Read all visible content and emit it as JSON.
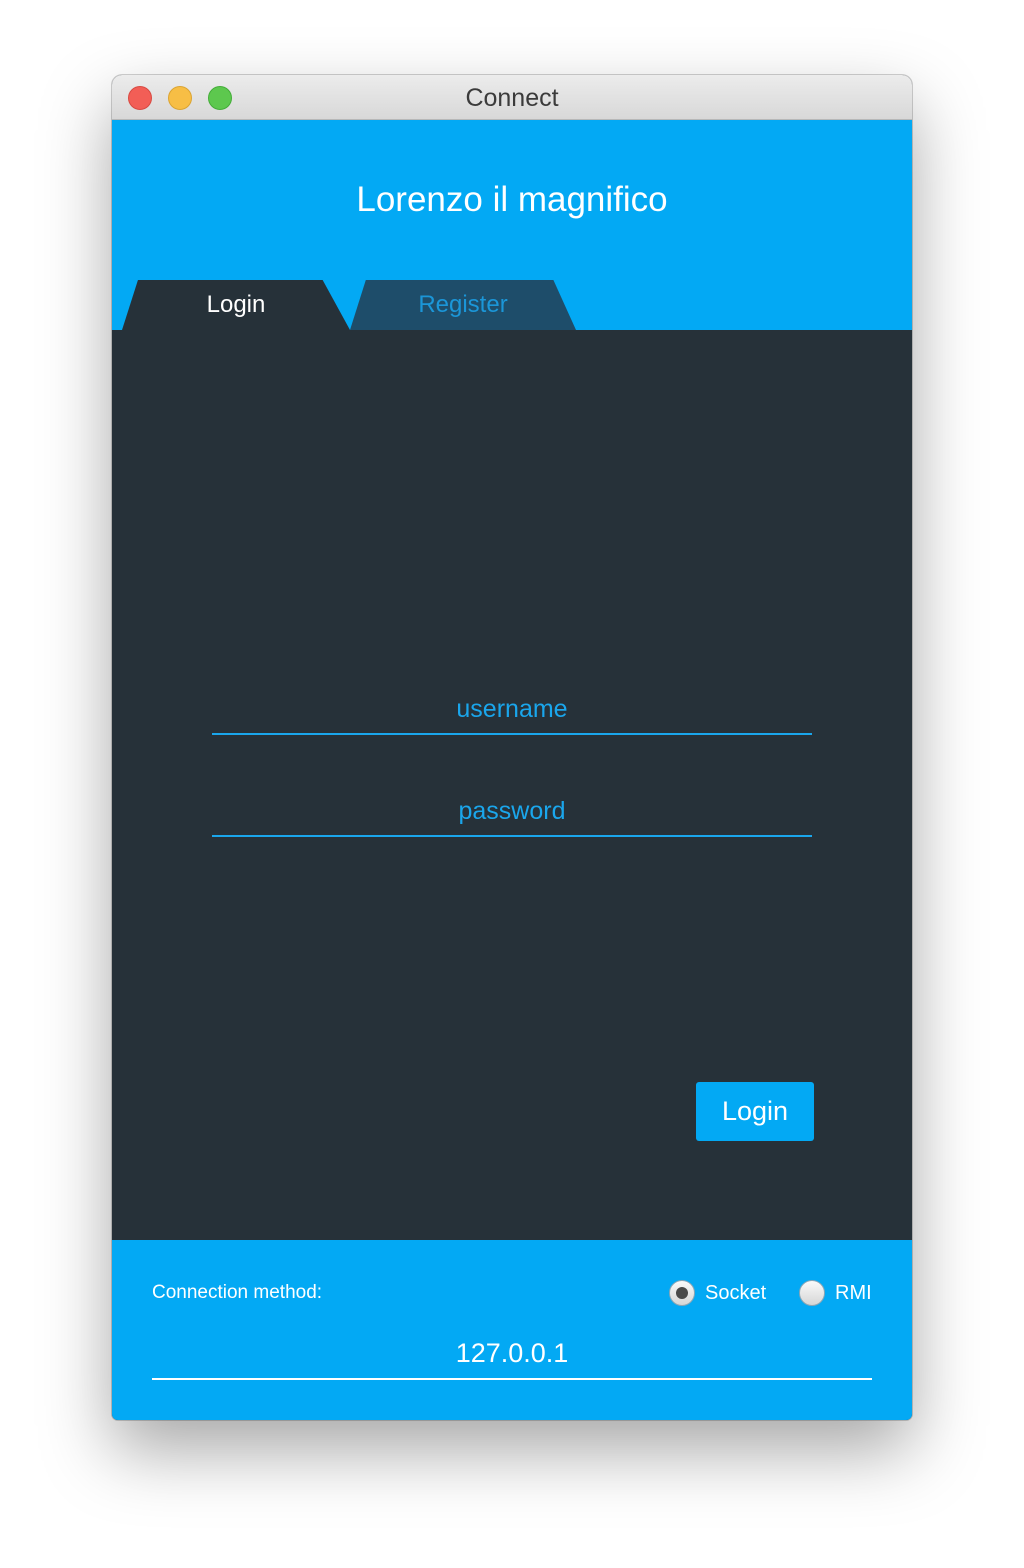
{
  "window": {
    "title": "Connect"
  },
  "header": {
    "app_title": "Lorenzo il magnifico",
    "tabs": [
      {
        "label": "Login",
        "selected": true
      },
      {
        "label": "Register",
        "selected": false
      }
    ]
  },
  "login_form": {
    "username_placeholder": "username",
    "password_placeholder": "password",
    "submit_label": "Login"
  },
  "footer": {
    "connection_label": "Connection method:",
    "options": [
      {
        "label": "Socket",
        "selected": true
      },
      {
        "label": "RMI",
        "selected": false
      }
    ],
    "server_address": "127.0.0.1"
  },
  "colors": {
    "accent": "#03a9f4",
    "panel": "#263139",
    "inactive_tab": "#1e4d6a"
  }
}
